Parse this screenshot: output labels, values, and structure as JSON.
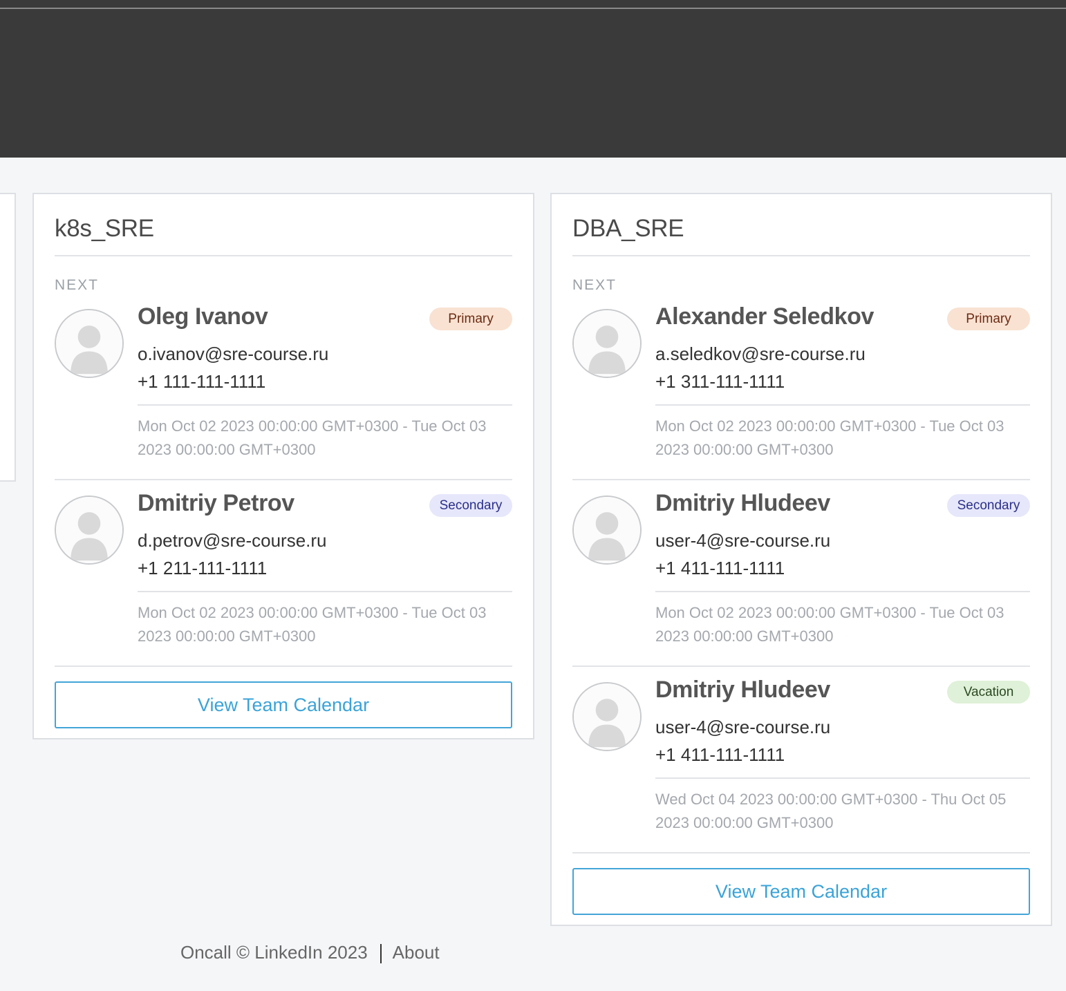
{
  "teams": [
    {
      "name": "k8s_SRE",
      "next_label": "NEXT",
      "entries": [
        {
          "name": "Oleg Ivanov",
          "role": "Primary",
          "email": "o.ivanov@sre-course.ru",
          "phone": "+1 111-111-1111",
          "range": "Mon Oct 02 2023 00:00:00 GMT+0300 - Tue Oct 03 2023 00:00:00 GMT+0300"
        },
        {
          "name": "Dmitriy Petrov",
          "role": "Secondary",
          "email": "d.petrov@sre-course.ru",
          "phone": "+1 211-111-1111",
          "range": "Mon Oct 02 2023 00:00:00 GMT+0300 - Tue Oct 03 2023 00:00:00 GMT+0300"
        }
      ],
      "calendar_button": "View Team Calendar"
    },
    {
      "name": "DBA_SRE",
      "next_label": "NEXT",
      "entries": [
        {
          "name": "Alexander Seledkov",
          "role": "Primary",
          "email": "a.seledkov@sre-course.ru",
          "phone": "+1 311-111-1111",
          "range": "Mon Oct 02 2023 00:00:00 GMT+0300 - Tue Oct 03 2023 00:00:00 GMT+0300"
        },
        {
          "name": "Dmitriy Hludeev",
          "role": "Secondary",
          "email": "user-4@sre-course.ru",
          "phone": "+1 411-111-1111",
          "range": "Mon Oct 02 2023 00:00:00 GMT+0300 - Tue Oct 03 2023 00:00:00 GMT+0300"
        },
        {
          "name": "Dmitriy Hludeev",
          "role": "Vacation",
          "email": "user-4@sre-course.ru",
          "phone": "+1 411-111-1111",
          "range": "Wed Oct 04 2023 00:00:00 GMT+0300 - Thu Oct 05 2023 00:00:00 GMT+0300"
        }
      ],
      "calendar_button": "View Team Calendar"
    }
  ],
  "footer": {
    "copyright": "Oncall © LinkedIn 2023",
    "about": "About"
  },
  "colors": {
    "header_bg": "#3a3a3a",
    "page_bg": "#f5f6f8",
    "accent": "#3aa3d8",
    "primary_badge": "#f9e2d2",
    "secondary_badge": "#e6e7fa",
    "vacation_badge": "#dff1d8"
  }
}
